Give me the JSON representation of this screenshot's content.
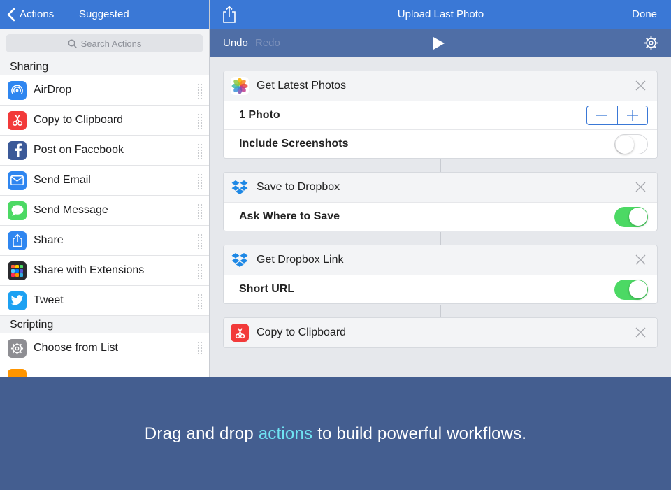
{
  "left_panel": {
    "back_label": "Actions",
    "title": "Suggested",
    "search_placeholder": "Search Actions",
    "sections": [
      {
        "title": "Sharing",
        "items": [
          {
            "label": "AirDrop",
            "icon": "airdrop-icon",
            "color": "#2f86f0"
          },
          {
            "label": "Copy to Clipboard",
            "icon": "scissors-icon",
            "color": "#f23a3a"
          },
          {
            "label": "Post on Facebook",
            "icon": "facebook-icon",
            "color": "#3b5998"
          },
          {
            "label": "Send Email",
            "icon": "mail-icon",
            "color": "#2f86f0"
          },
          {
            "label": "Send Message",
            "icon": "message-icon",
            "color": "#4cd964"
          },
          {
            "label": "Share",
            "icon": "share-icon",
            "color": "#2f86f0"
          },
          {
            "label": "Share with Extensions",
            "icon": "extensions-icon",
            "color": "#2a2a2e"
          },
          {
            "label": "Tweet",
            "icon": "twitter-icon",
            "color": "#1da1f2"
          }
        ]
      },
      {
        "title": "Scripting",
        "items": [
          {
            "label": "Choose from List",
            "icon": "gear-icon",
            "color": "#8e8e93"
          }
        ]
      }
    ]
  },
  "right_panel": {
    "title": "Upload Last Photo",
    "done_label": "Done",
    "undo_label": "Undo",
    "redo_label": "Redo",
    "actions": [
      {
        "title": "Get Latest Photos",
        "icon": "photos-icon",
        "params": [
          {
            "label": "1 Photo",
            "control": "stepper"
          },
          {
            "label": "Include Screenshots",
            "control": "toggle",
            "value": false
          }
        ]
      },
      {
        "title": "Save to Dropbox",
        "icon": "dropbox-icon",
        "params": [
          {
            "label": "Ask Where to Save",
            "control": "toggle",
            "value": true
          }
        ]
      },
      {
        "title": "Get Dropbox Link",
        "icon": "dropbox-icon",
        "params": [
          {
            "label": "Short URL",
            "control": "toggle",
            "value": true
          }
        ]
      },
      {
        "title": "Copy to Clipboard",
        "icon": "scissors-icon",
        "params": []
      }
    ]
  },
  "banner": {
    "before": "Drag and drop ",
    "highlight": "actions",
    "after": " to build powerful workflows."
  },
  "colors": {
    "header_blue": "#3a78d6",
    "toolbar_blue": "#4f6ea6",
    "banner_blue": "#445e90",
    "toggle_on": "#4cd964",
    "highlight": "#6fe3f2"
  }
}
